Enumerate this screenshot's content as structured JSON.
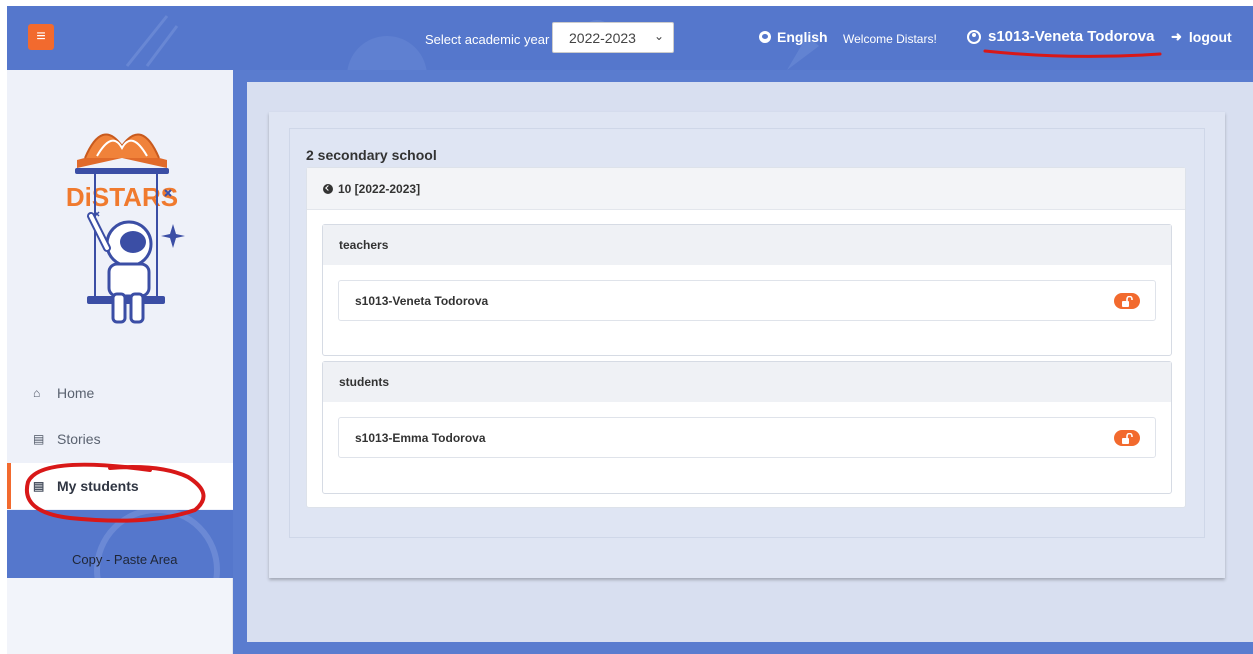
{
  "header": {
    "menu_icon": "hamburger-icon",
    "year_label": "Select academic year",
    "year_selected": "2022-2023",
    "language": "English",
    "welcome": "Welcome Distars!",
    "user": "s1013-Veneta Todorova",
    "logout": "logout",
    "accent_color": "#f26a2e",
    "bar_color": "#5577cc"
  },
  "sidebar": {
    "logo_text": "DiSTARS",
    "items": [
      {
        "label": "Home",
        "icon": "home-icon"
      },
      {
        "label": "Stories",
        "icon": "stories-icon"
      },
      {
        "label": "My students",
        "icon": "students-icon",
        "active": true
      }
    ],
    "copy_area": "Copy - Paste Area"
  },
  "main": {
    "school": "2 secondary school",
    "class_title": "10 [2022-2023]",
    "groups": [
      {
        "title": "teachers",
        "members": [
          {
            "name": "s1013-Veneta Todorova",
            "icon": "unlock-icon"
          }
        ]
      },
      {
        "title": "students",
        "members": [
          {
            "name": "s1013-Emma Todorova",
            "icon": "unlock-icon"
          }
        ]
      }
    ]
  }
}
